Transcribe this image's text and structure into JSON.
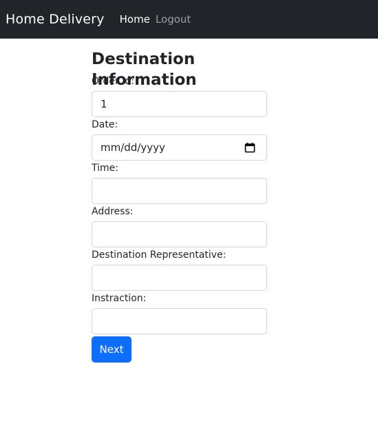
{
  "navbar": {
    "brand": "Home Delivery",
    "links": [
      {
        "label": "Home"
      },
      {
        "label": "Logout"
      }
    ]
  },
  "form": {
    "title": "Destination Information",
    "fields": {
      "order_id": {
        "label": "Order Id:",
        "value": "1"
      },
      "date": {
        "label": "Date:",
        "placeholder": "mm/dd/yyyy",
        "icon": "calendar-icon"
      },
      "time": {
        "label": "Time:",
        "value": ""
      },
      "address": {
        "label": "Address:",
        "value": ""
      },
      "representative": {
        "label": "Destination Representative:",
        "value": ""
      },
      "instruction": {
        "label": "Instraction:",
        "value": ""
      }
    },
    "submit_label": "Next"
  },
  "colors": {
    "navbar_bg": "#212529",
    "primary": "#0d6efd",
    "input_border": "#ced4da"
  }
}
